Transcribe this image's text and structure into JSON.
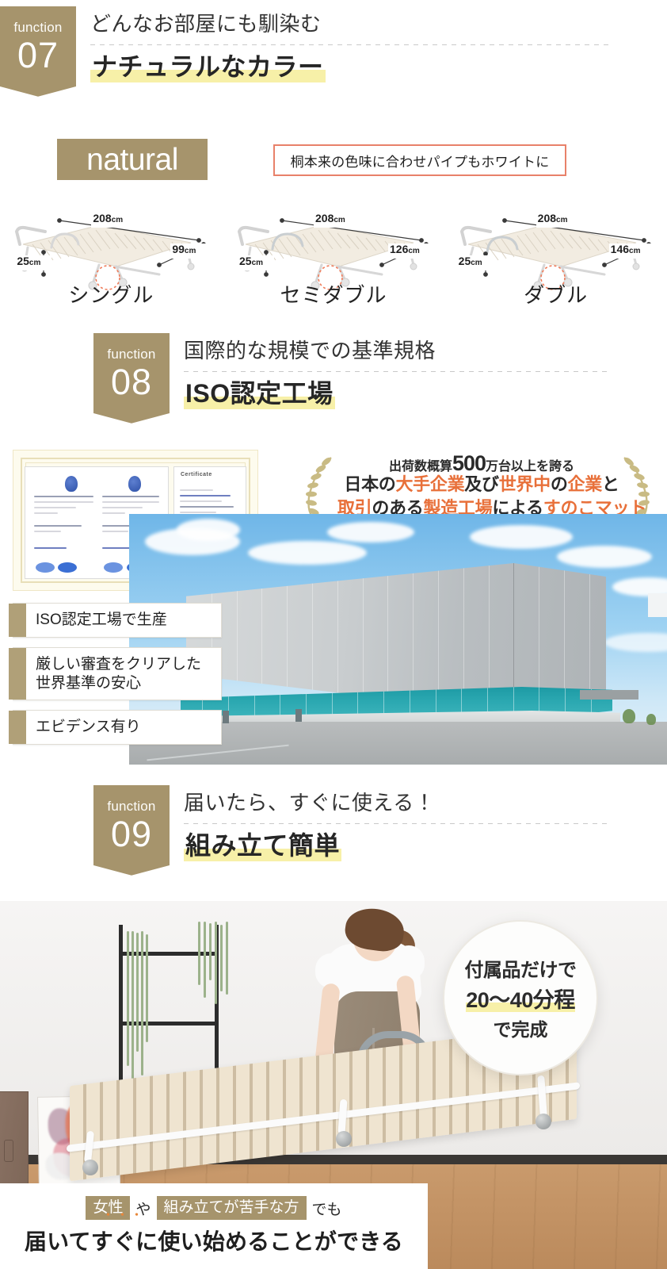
{
  "sections": {
    "fn07": {
      "word": "function",
      "number": "07",
      "sub": "どんなお部屋にも馴染む",
      "main": "ナチュラルなカラー"
    },
    "fn08": {
      "word": "function",
      "number": "08",
      "sub": "国際的な規模での基準規格",
      "main": "ISO認定工場"
    },
    "fn09": {
      "word": "function",
      "number": "09",
      "sub": "届いたら、すぐに使える！",
      "main": "組み立て簡単"
    }
  },
  "natural": {
    "badge": "natural",
    "pipe_note": "桐本来の色味に合わせパイプもホワイトに"
  },
  "beds": [
    {
      "name": "シングル",
      "length": "208",
      "length_unit": "cm",
      "height": "25",
      "height_unit": "cm",
      "width": "99",
      "width_unit": "cm"
    },
    {
      "name": "セミダブル",
      "length": "208",
      "length_unit": "cm",
      "height": "25",
      "height_unit": "cm",
      "width": "126",
      "width_unit": "cm"
    },
    {
      "name": "ダブル",
      "length": "208",
      "length_unit": "cm",
      "height": "25",
      "height_unit": "cm",
      "width": "146",
      "width_unit": "cm"
    }
  ],
  "certificate": {
    "heading_title": "Certificate"
  },
  "laurel": {
    "line1_pre": "出荷数概算",
    "line1_big": "500",
    "line1_post": "万台以上を誇る",
    "line2": "日本の大手企業及び世界中の企業と",
    "line3": "取引のある製造工場によるすのこマット",
    "line2_parts": [
      {
        "t": "日本の",
        "c": "dark"
      },
      {
        "t": "大手企業",
        "c": "orange"
      },
      {
        "t": "及び",
        "c": "dark"
      },
      {
        "t": "世界中",
        "c": "orange"
      },
      {
        "t": "の",
        "c": "dark"
      },
      {
        "t": "企業",
        "c": "orange"
      },
      {
        "t": "と",
        "c": "dark"
      }
    ],
    "line3_parts": [
      {
        "t": "取引",
        "c": "orange"
      },
      {
        "t": "のある",
        "c": "dark"
      },
      {
        "t": "製造工場",
        "c": "orange"
      },
      {
        "t": "による",
        "c": "dark"
      },
      {
        "t": "すのこマット",
        "c": "orange"
      }
    ]
  },
  "iso_tags": [
    "ISO認定工場で生産",
    "厳しい審査をクリアした\n世界基準の安心",
    "エビデンス有り"
  ],
  "assembly_badge": {
    "line1": "付属品だけで",
    "line2": "20〜40分程",
    "line3": "で完成"
  },
  "bottom_caption": {
    "tag1": "女性",
    "between": "や",
    "tag2": "組み立てが苦手な方",
    "suffix": "でも",
    "line2_a": "届いて",
    "line2_b": "すぐに",
    "line2_c": "使い始めることができる"
  },
  "colors": {
    "ribbon": "#a6946c",
    "highlight": "#f7f0a8",
    "accent_orange": "#e8703a",
    "note_border": "#e8816a"
  }
}
